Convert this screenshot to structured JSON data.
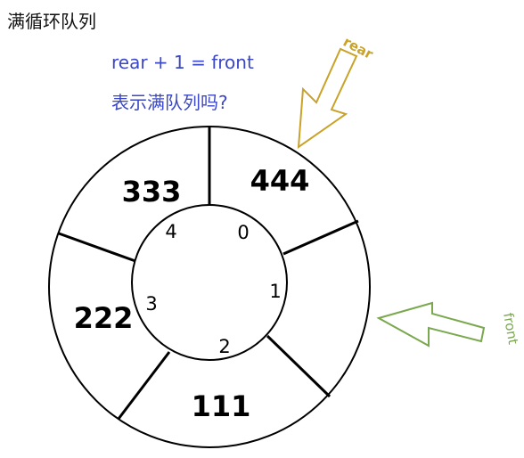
{
  "title": "满循环队列",
  "question": {
    "line1": "rear + 1 = front",
    "line2": "表示满队列吗?"
  },
  "ring": {
    "values": [
      "444",
      "",
      "111",
      "222",
      "333"
    ],
    "indices": [
      "0",
      "1",
      "2",
      "3",
      "4"
    ]
  },
  "pointers": {
    "rear": "rear",
    "front": "front"
  },
  "colors": {
    "question": "#3b47c4",
    "rear": "#c9a227",
    "front": "#7aa84f",
    "stroke": "#000000"
  }
}
